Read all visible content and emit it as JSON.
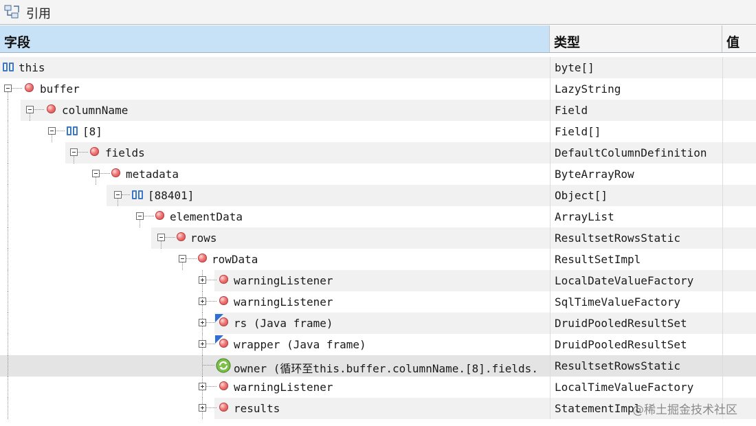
{
  "panel": {
    "title": "引用",
    "icon": "references-icon"
  },
  "columns": {
    "field": "字段",
    "type": "类型",
    "value": "值"
  },
  "rows": [
    {
      "name": "this",
      "type": "byte[]",
      "icon": "array-icon"
    },
    {
      "name": "buffer",
      "type": "LazyString",
      "icon": "field-icon"
    },
    {
      "name": "columnName",
      "type": "Field",
      "icon": "field-icon"
    },
    {
      "name": "[8]",
      "type": "Field[]",
      "icon": "array-icon"
    },
    {
      "name": "fields",
      "type": "DefaultColumnDefinition",
      "icon": "field-icon"
    },
    {
      "name": "metadata",
      "type": "ByteArrayRow",
      "icon": "field-icon"
    },
    {
      "name": "[88401]",
      "type": "Object[]",
      "icon": "array-icon"
    },
    {
      "name": "elementData",
      "type": "ArrayList",
      "icon": "field-icon"
    },
    {
      "name": "rows",
      "type": "ResultsetRowsStatic",
      "icon": "field-icon"
    },
    {
      "name": "rowData",
      "type": "ResultSetImpl",
      "icon": "field-icon"
    },
    {
      "name": "warningListener",
      "type": "LocalDateValueFactory",
      "icon": "field-icon"
    },
    {
      "name": "warningListener",
      "type": "SqlTimeValueFactory",
      "icon": "field-icon"
    },
    {
      "name": "rs (Java frame)",
      "type": "DruidPooledResultSet",
      "icon": "java-frame-field-icon"
    },
    {
      "name": "wrapper (Java frame)",
      "type": "DruidPooledResultSet",
      "icon": "java-frame-field-icon"
    },
    {
      "name": "owner (循环至this.buffer.columnName.[8].fields.",
      "type": "ResultsetRowsStatic",
      "icon": "cycle-icon"
    },
    {
      "name": "warningListener",
      "type": "LocalTimeValueFactory",
      "icon": "field-icon"
    },
    {
      "name": "results",
      "type": "StatementImpl",
      "icon": "field-icon"
    }
  ],
  "watermark": "@稀土掘金技术社区"
}
